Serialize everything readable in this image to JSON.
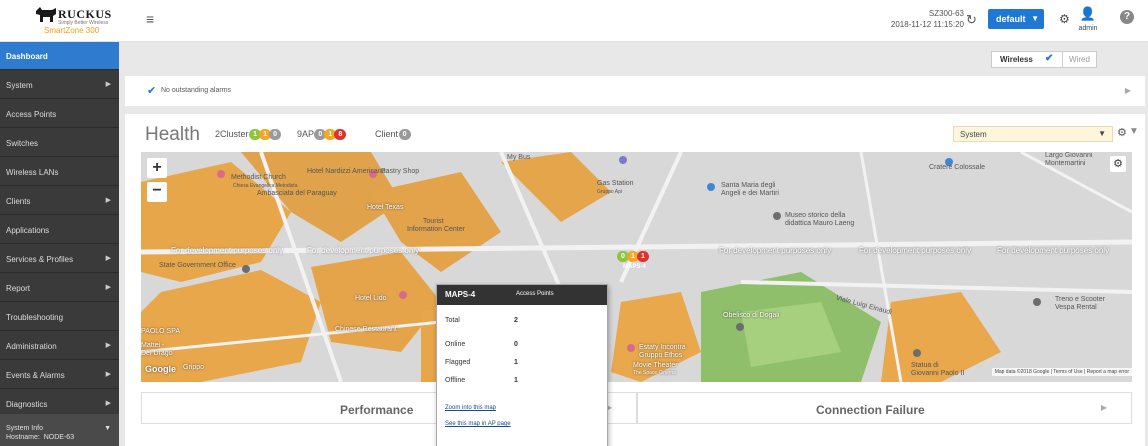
{
  "header": {
    "brand": "RUCKUS",
    "brand_tag": "Simply Better Wireless",
    "product": "SmartZone 300",
    "system_name": "SZ300-63",
    "datetime": "2018-11-12  11:15:20",
    "domain": "default",
    "user": "admin"
  },
  "sidebar": {
    "items": [
      {
        "label": "Dashboard",
        "arrow": ""
      },
      {
        "label": "System",
        "arrow": "▶"
      },
      {
        "label": "Access Points",
        "arrow": ""
      },
      {
        "label": "Switches",
        "arrow": ""
      },
      {
        "label": "Wireless LANs",
        "arrow": ""
      },
      {
        "label": "Clients",
        "arrow": "▶"
      },
      {
        "label": "Applications",
        "arrow": ""
      },
      {
        "label": "Services & Profiles",
        "arrow": "▶"
      },
      {
        "label": "Report",
        "arrow": "▶"
      },
      {
        "label": "Troubleshooting",
        "arrow": ""
      },
      {
        "label": "Administration",
        "arrow": "▶"
      },
      {
        "label": "Events & Alarms",
        "arrow": "▶"
      },
      {
        "label": "Diagnostics",
        "arrow": "▶"
      }
    ],
    "system_info_label": "System Info",
    "hostname_label": "Hostname:",
    "hostname_value": "NODE-63"
  },
  "tabs": {
    "wireless": "Wireless",
    "wired": "Wired"
  },
  "alarms": {
    "text": "No outstanding alarms"
  },
  "health": {
    "title": "Health",
    "cluster_count": "2",
    "cluster_label": "Cluster",
    "cluster_pills": [
      "1",
      "1",
      "0"
    ],
    "ap_count": "9",
    "ap_label": "AP",
    "ap_pills": [
      "0",
      "1",
      "8"
    ],
    "client_label": "Client",
    "client_pill": "0",
    "scope_select": "System"
  },
  "map": {
    "dev_notice": "For development purposes only",
    "labels": {
      "methodist": "Methodist Church",
      "methodist_sub": "Chiesa Evangelica Metodista",
      "nardizzi": "Hotel Nardizzi Americana",
      "pastry": "Pastry Shop",
      "mybus": "My Bus",
      "gas": "Gas Station",
      "gas_sub": "Gruppo Api",
      "santa_maria": "Santa Maria degli",
      "santa_maria2": "Angeli e dei Martiri",
      "cratere": "Cratere Colossale",
      "largo": "Largo Giovanni",
      "largo2": "Montemartini",
      "paraguay": "Ambasciata del Paraguay",
      "museo": "Museo storico della",
      "museo2": "didattica Mauro Laeng",
      "hotel_texas": "Hotel Texas",
      "tourist": "Tourist",
      "tourist2": "Information Center",
      "state_gov": "State Government Office",
      "hotel_lido": "Hotel Lido",
      "chinese": "Chinese Restaurant",
      "viale": "Viale Luigi Einaudi",
      "obelisco": "Obelisco di Dogali",
      "estaty": "Estaty Incontra",
      "estaty2": "Gruppo Ethos",
      "movie": "Movie Theater",
      "movie2": "The Space Cinema",
      "treno": "Treno e Scooter",
      "treno2": "Vespa Rental",
      "statua": "Statua di",
      "statua2": "Giovanni Paolo II",
      "mattei": "Mattei -",
      "drago": "Del Drago",
      "spa": "PAOLO SPA",
      "grippo": "Grippo"
    },
    "marker_name": "MAPS-4",
    "marker_pills": [
      "0",
      "1",
      "1"
    ],
    "attribution": "Map data ©2018 Google | Terms of Use | Report a map error",
    "google": "Google"
  },
  "popup": {
    "title": "MAPS-4",
    "subtitle": "Access Points",
    "total_label": "Total",
    "total": "2",
    "online_label": "Online",
    "online": "0",
    "flagged_label": "Flagged",
    "flagged": "1",
    "offline_label": "Offline",
    "offline": "1",
    "link_zoom": "Zoom into this map",
    "link_ap": "See this map in AP page"
  },
  "tiles": {
    "performance": "Performance",
    "connection_failure": "Connection Failure"
  },
  "colors": {
    "accent": "#2e7bcf",
    "sidebar_bg": "#3a3a3a",
    "online_green": "#8cc63f",
    "flagged_orange": "#f5a623",
    "offline_red": "#d9352e"
  }
}
